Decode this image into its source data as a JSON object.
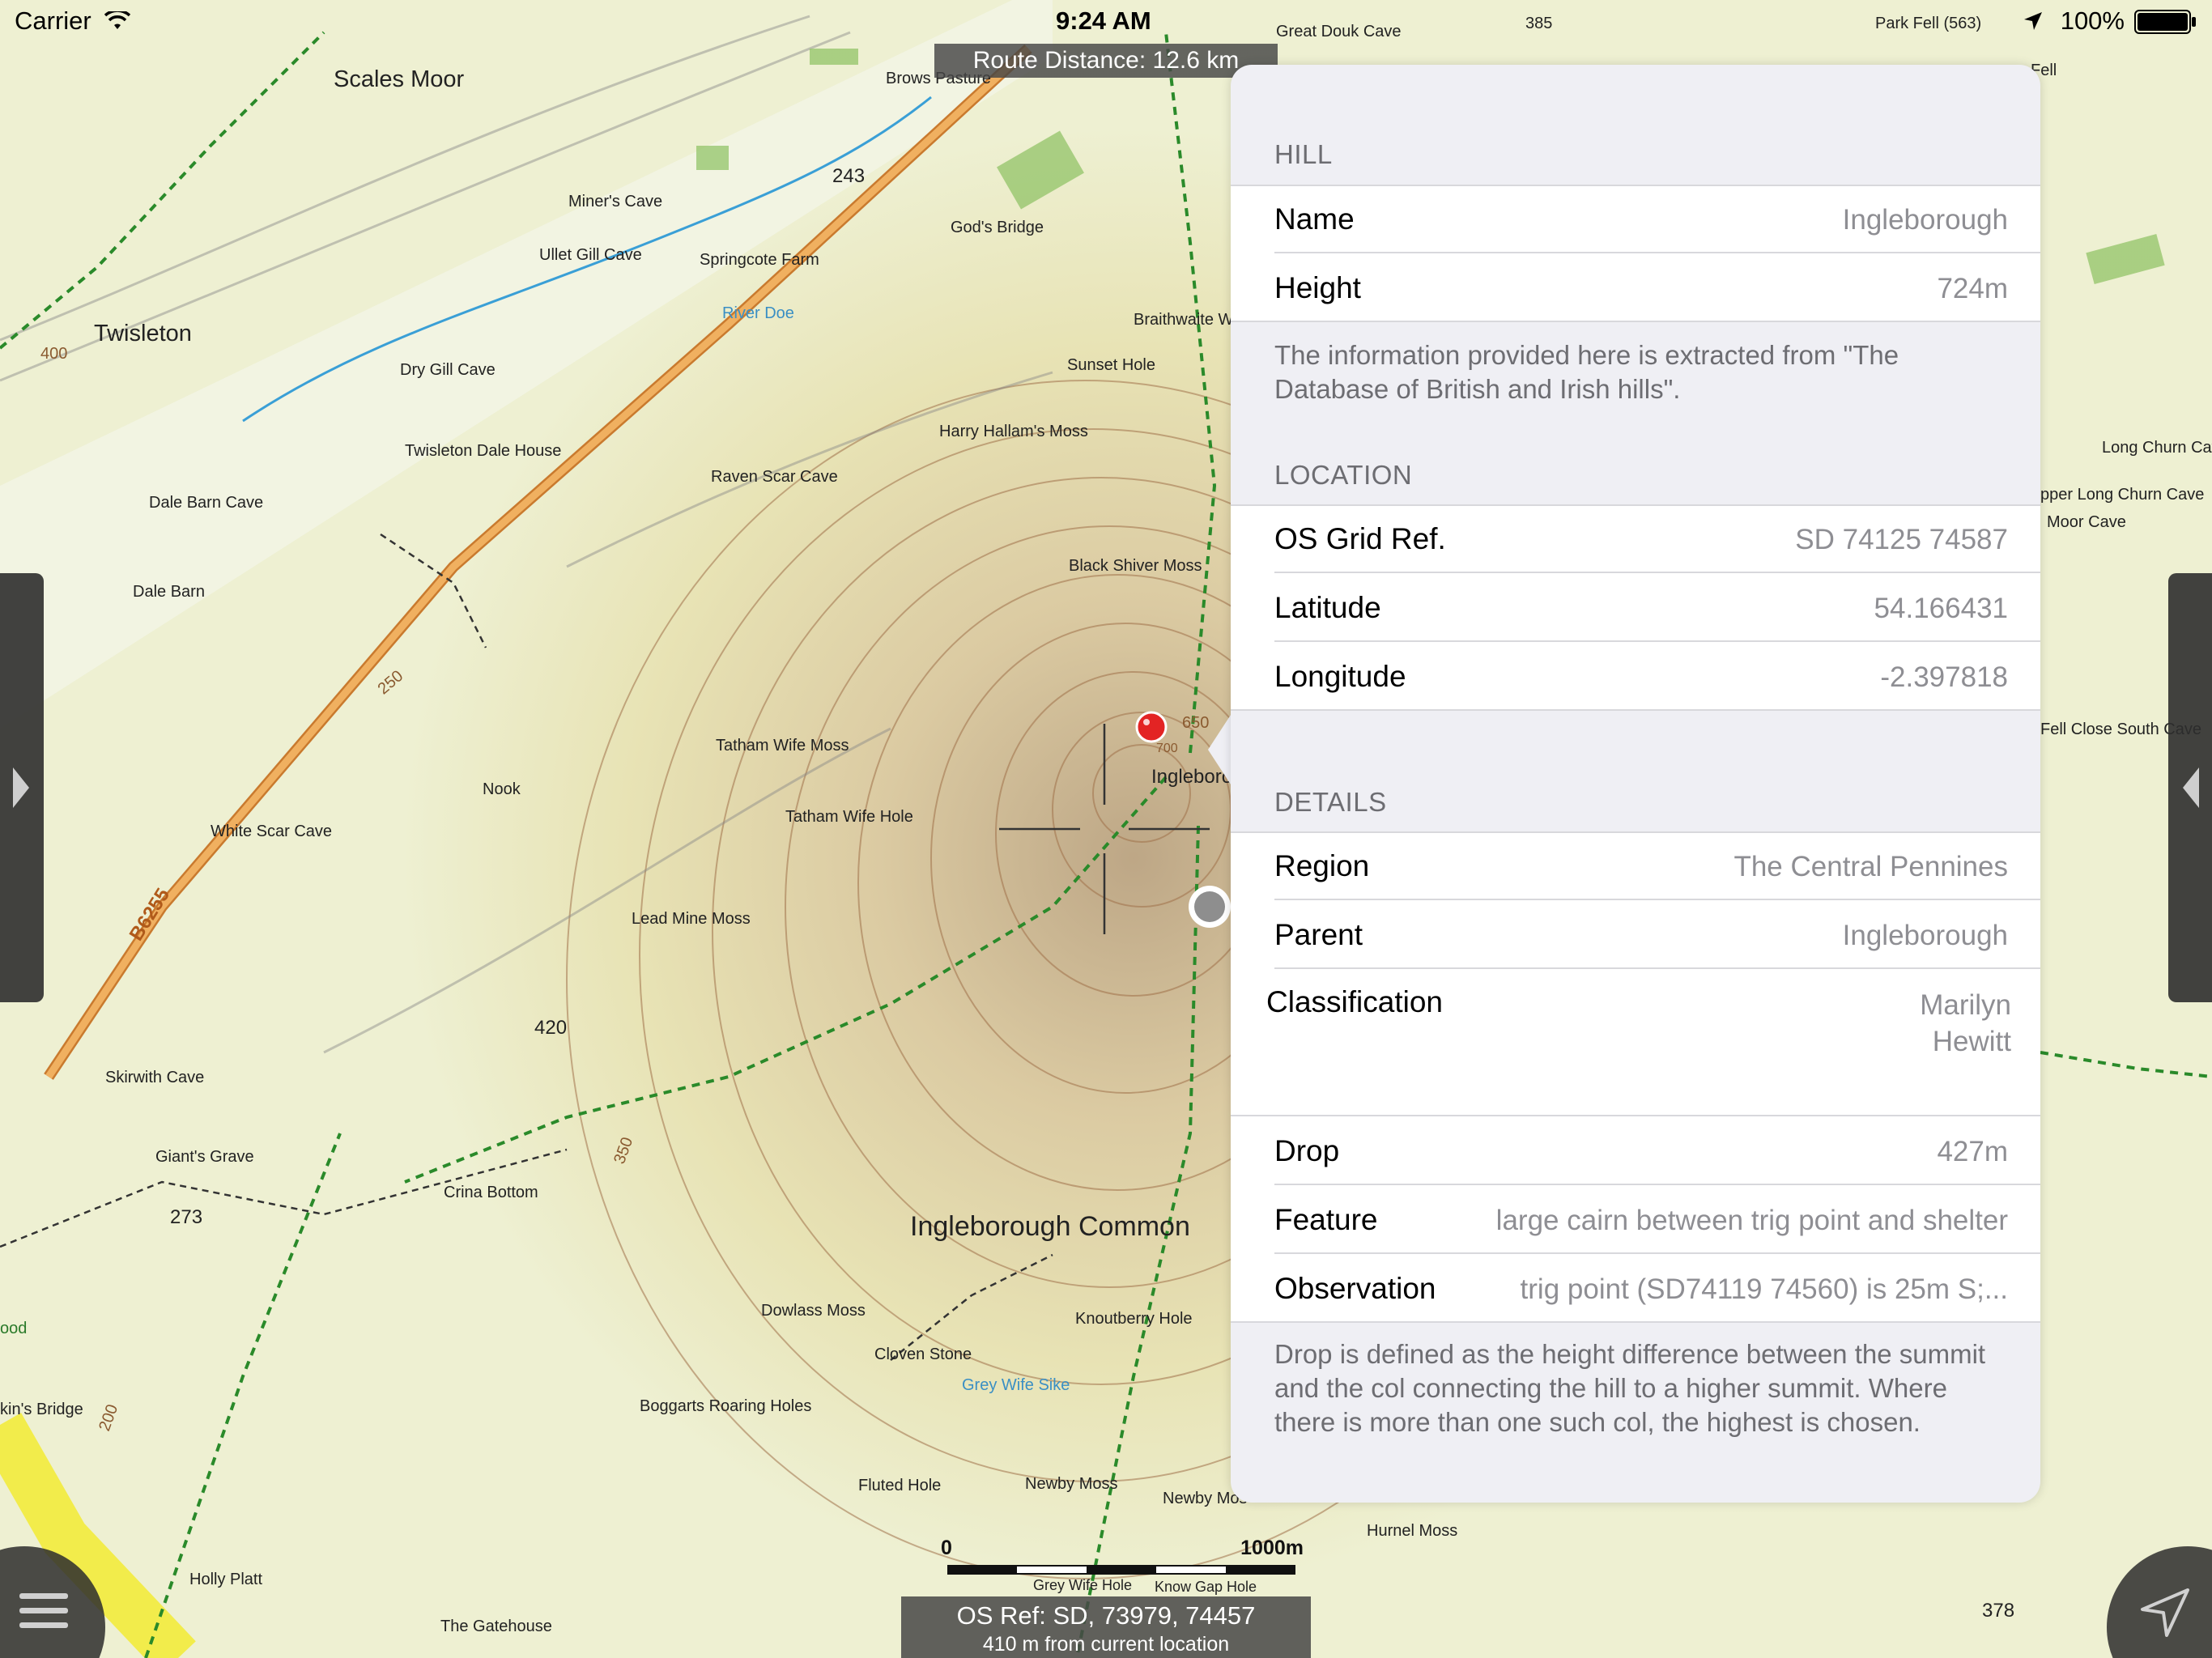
{
  "status_bar": {
    "carrier": "Carrier",
    "time": "9:24 AM",
    "battery": "100%"
  },
  "map": {
    "route_distance": "Route Distance: 12.6 km",
    "os_ref": "OS Ref: SD, 73979, 74457",
    "os_ref_distance": "410 m from current location",
    "scale": {
      "start": "0",
      "end": "1000m"
    },
    "labels": {
      "scales_moor": "Scales Moor",
      "twisleton": "Twisleton",
      "ingleborough_common": "Ingleborough Common",
      "great_douk_cave": "Great Douk Cave",
      "park_fell": "Park Fell (563)",
      "spot_385": "385",
      "brows_pasture": "Brows Pasture",
      "spot_243": "243",
      "miners_cave": "Miner's Cave",
      "ullet_gill_cave": "Ullet Gill Cave",
      "springcote_farm": "Springcote Farm",
      "gods_bridge": "God's Bridge",
      "river_doe": "River Doe",
      "dry_gill_cave": "Dry Gill Cave",
      "braithwaite": "Braithwaite W",
      "sunset_hole": "Sunset Hole",
      "harry_hallams_moss": "Harry Hallam's Moss",
      "twisleton_dale_house": "Twisleton Dale House",
      "raven_scar_cave": "Raven Scar Cave",
      "dale_barn_cave": "Dale Barn Cave",
      "dale_barn": "Dale Barn",
      "black_shiver_moss": "Black Shiver Moss",
      "tatham_wife_moss": "Tatham Wife Moss",
      "tatham_wife_hole": "Tatham Wife Hole",
      "nook": "Nook",
      "white_scar_cave": "White Scar Cave",
      "lead_mine_moss": "Lead Mine Moss",
      "b6255": "B6255",
      "spot_420": "420",
      "skirwith_cave": "Skirwith Cave",
      "giants_grave": "Giant's Grave",
      "crina_bottom": "Crina Bottom",
      "spot_273": "273",
      "dowlass_moss": "Dowlass Moss",
      "cloven_stone": "Cloven Stone",
      "grey_wife_sike": "Grey Wife Sike",
      "knoutberry_hole": "Knoutberry Hole",
      "boggarts_roaring_holes": "Boggarts Roaring Holes",
      "fluted_hole": "Fluted Hole",
      "newby_moss": "Newby Moss",
      "newby_mos_edge": "Newby Mos",
      "hurnel_moss": "Hurnel Moss",
      "holly_platt": "Holly Platt",
      "the_gatehouse": "The Gatehouse",
      "grey_wife_hole": "Grey Wife Hole",
      "know_gap_hole": "Know Gap Hole",
      "kins_bridge": "kin's Bridge",
      "ood": "ood",
      "long_churn_cave": "Long Churn Cave",
      "upper_long_churn_cave": "pper Long Churn Cave",
      "moor_cave": "Moor Cave",
      "fell_close_south_cave": "Fell Close South Cave",
      "fell_edge": "Fell",
      "spot_378": "378",
      "ingleborough_map": "Ingleboro",
      "contour_650": "650",
      "contour_700": "700",
      "contour_250": "250",
      "contour_350": "350",
      "contour_200": "200",
      "contour_400": "400"
    }
  },
  "panel": {
    "hill": {
      "header": "HILL",
      "rows": [
        {
          "label": "Name",
          "value": "Ingleborough"
        },
        {
          "label": "Height",
          "value": "724m"
        }
      ],
      "footnote": "The information provided here is extracted from \"The Database of British and Irish hills\"."
    },
    "location": {
      "header": "LOCATION",
      "rows": [
        {
          "label": "OS Grid Ref.",
          "value": "SD 74125 74587"
        },
        {
          "label": "Latitude",
          "value": "54.166431"
        },
        {
          "label": "Longitude",
          "value": "-2.397818"
        }
      ]
    },
    "details": {
      "header": "DETAILS",
      "rows": [
        {
          "label": "Region",
          "value": "The Central Pennines"
        },
        {
          "label": "Parent",
          "value": "Ingleborough"
        }
      ],
      "classification": {
        "label": "Classification",
        "values": [
          "Marilyn",
          "Hewitt"
        ]
      },
      "rows2": [
        {
          "label": "Drop",
          "value": "427m"
        },
        {
          "label": "Feature",
          "value": "large cairn between trig point and shelter"
        },
        {
          "label": "Observation",
          "value": "trig point (SD74119 74560) is 25m S;..."
        }
      ],
      "footnote": "Drop is defined as the height difference between the summit and the col connecting the hill to a higher summit. Where there is more than one such col, the highest is chosen."
    }
  },
  "colors": {
    "panel_bg": "#efeff4",
    "secondary_text": "#8e8e93",
    "section_text": "#6d6d72",
    "pin": "#e32424",
    "path_green": "#2a8a2a",
    "road": "#e89a4a",
    "river": "#3a9fd6"
  },
  "icons": [
    "wifi-icon",
    "location-arrow-icon",
    "battery-icon",
    "hamburger-menu-icon",
    "navigation-arrow-icon",
    "chevron-right-icon",
    "chevron-left-icon",
    "map-pin-icon",
    "crosshair-icon",
    "current-location-dot-icon"
  ]
}
